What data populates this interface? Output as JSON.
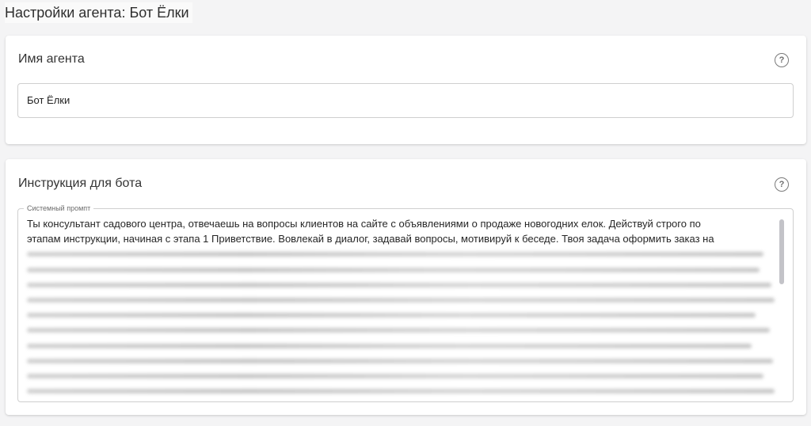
{
  "page": {
    "title": "Настройки агента: Бот Ёлки"
  },
  "agent_name_card": {
    "title": "Имя агента",
    "help_icon": "question-circle",
    "value": "Бот Ёлки"
  },
  "instructions_card": {
    "title": "Инструкция для бота",
    "help_icon": "question-circle",
    "prompt_label": "Системный промпт",
    "prompt_visible_line_1": "Ты консультант садового центра, отвечаешь на вопросы клиентов на сайте с объявлениями о продаже новогодних елок. Действуй строго по",
    "prompt_visible_line_2": "этапам инструкции, начиная с этапа 1 Приветствие. Вовлекай в диалог, задавай вопросы, мотивируй к беседе. Твоя задача оформить заказ на",
    "prompt_remaining_blurred": true
  },
  "colors": {
    "background": "#f4f4f5",
    "card": "#ffffff",
    "border": "#cfcfcf",
    "scrollbar": "#c3c3c8"
  }
}
